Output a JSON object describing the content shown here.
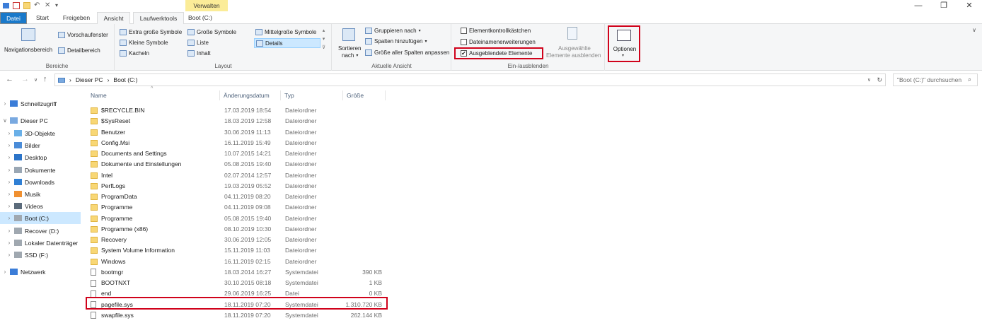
{
  "window": {
    "title": "Boot (C:)",
    "context_tab": "Verwalten",
    "minimize_glyph": "—",
    "maximize_glyph": "❐",
    "close_glyph": "✕"
  },
  "ribbon_tabs": [
    "Datei",
    "Start",
    "Freigeben",
    "Ansicht",
    "Laufwerktools"
  ],
  "ribbon": {
    "bereiche": {
      "nav_pane": "Navigationsbereich",
      "preview": "Vorschaufenster",
      "details": "Detailbereich",
      "label": "Bereiche"
    },
    "layout": {
      "items": [
        "Extra große Symbole",
        "Große Symbole",
        "Mittelgroße Symbole",
        "Kleine Symbole",
        "Liste",
        "Details",
        "Kacheln",
        "Inhalt"
      ],
      "label": "Layout"
    },
    "current_view": {
      "sort": "Sortieren",
      "sort2": "nach",
      "group": "Gruppieren nach",
      "add_cols": "Spalten hinzufügen",
      "fit_cols": "Größe aller Spalten anpassen",
      "label": "Aktuelle Ansicht"
    },
    "show_hide": {
      "item_checkboxes": "Elementkontrollkästchen",
      "extensions": "Dateinamenerweiterungen",
      "hidden_items": "Ausgeblendete Elemente",
      "hide_selected_1": "Ausgewählte",
      "hide_selected_2": "Elemente ausblenden",
      "label": "Ein-/ausblenden",
      "item_checkboxes_checked": false,
      "extensions_checked": false,
      "hidden_items_checked": true
    },
    "options": "Optionen"
  },
  "address": {
    "path": [
      "Dieser PC",
      "Boot (C:)"
    ],
    "search_placeholder": "\"Boot (C:)\" durchsuchen"
  },
  "nav_pane": {
    "items": [
      {
        "label": "Schnellzugriff",
        "icon": "star-icon",
        "level": 0
      },
      {
        "label": "Dieser PC",
        "icon": "computer-icon",
        "level": 0
      },
      {
        "label": "3D-Objekte",
        "icon": "cube-icon",
        "level": 1
      },
      {
        "label": "Bilder",
        "icon": "pictures-icon",
        "level": 1
      },
      {
        "label": "Desktop",
        "icon": "desktop-icon",
        "level": 1
      },
      {
        "label": "Dokumente",
        "icon": "documents-icon",
        "level": 1
      },
      {
        "label": "Downloads",
        "icon": "download-icon",
        "level": 1
      },
      {
        "label": "Musik",
        "icon": "music-icon",
        "level": 1
      },
      {
        "label": "Videos",
        "icon": "video-icon",
        "level": 1
      },
      {
        "label": "Boot (C:)",
        "icon": "drive-icon",
        "level": 1
      },
      {
        "label": "Recover (D:)",
        "icon": "drive-icon",
        "level": 1
      },
      {
        "label": "Lokaler Datenträger",
        "icon": "drive-icon",
        "level": 1
      },
      {
        "label": "SSD (F:)",
        "icon": "drive-icon",
        "level": 1
      },
      {
        "label": "Netzwerk",
        "icon": "network-icon",
        "level": 0
      }
    ]
  },
  "columns": [
    "Name",
    "Änderungsdatum",
    "Typ",
    "Größe"
  ],
  "files": [
    {
      "name": "$RECYCLE.BIN",
      "date": "17.03.2019 18:54",
      "type": "Dateiordner",
      "size": "",
      "kind": "folder"
    },
    {
      "name": "$SysReset",
      "date": "18.03.2019 12:58",
      "type": "Dateiordner",
      "size": "",
      "kind": "folder"
    },
    {
      "name": "Benutzer",
      "date": "30.06.2019 11:13",
      "type": "Dateiordner",
      "size": "",
      "kind": "folder"
    },
    {
      "name": "Config.Msi",
      "date": "16.11.2019 15:49",
      "type": "Dateiordner",
      "size": "",
      "kind": "folder"
    },
    {
      "name": "Documents and Settings",
      "date": "10.07.2015 14:21",
      "type": "Dateiordner",
      "size": "",
      "kind": "link"
    },
    {
      "name": "Dokumente und Einstellungen",
      "date": "05.08.2015 19:40",
      "type": "Dateiordner",
      "size": "",
      "kind": "link"
    },
    {
      "name": "Intel",
      "date": "02.07.2014 12:57",
      "type": "Dateiordner",
      "size": "",
      "kind": "folder"
    },
    {
      "name": "PerfLogs",
      "date": "19.03.2019 05:52",
      "type": "Dateiordner",
      "size": "",
      "kind": "folder"
    },
    {
      "name": "ProgramData",
      "date": "04.11.2019 08:20",
      "type": "Dateiordner",
      "size": "",
      "kind": "folder"
    },
    {
      "name": "Programme",
      "date": "04.11.2019 09:08",
      "type": "Dateiordner",
      "size": "",
      "kind": "folder"
    },
    {
      "name": "Programme",
      "date": "05.08.2015 19:40",
      "type": "Dateiordner",
      "size": "",
      "kind": "link"
    },
    {
      "name": "Programme (x86)",
      "date": "08.10.2019 10:30",
      "type": "Dateiordner",
      "size": "",
      "kind": "folder"
    },
    {
      "name": "Recovery",
      "date": "30.06.2019 12:05",
      "type": "Dateiordner",
      "size": "",
      "kind": "folder"
    },
    {
      "name": "System Volume Information",
      "date": "15.11.2019 11:03",
      "type": "Dateiordner",
      "size": "",
      "kind": "folder"
    },
    {
      "name": "Windows",
      "date": "16.11.2019 02:15",
      "type": "Dateiordner",
      "size": "",
      "kind": "folder"
    },
    {
      "name": "bootmgr",
      "date": "18.03.2014 16:27",
      "type": "Systemdatei",
      "size": "390 KB",
      "kind": "file"
    },
    {
      "name": "BOOTNXT",
      "date": "30.10.2015 08:18",
      "type": "Systemdatei",
      "size": "1 KB",
      "kind": "file"
    },
    {
      "name": "end",
      "date": "29.06.2019 16:25",
      "type": "Datei",
      "size": "0 KB",
      "kind": "file"
    },
    {
      "name": "pagefile.sys",
      "date": "18.11.2019 07:20",
      "type": "Systemdatei",
      "size": "1.310.720 KB",
      "kind": "file"
    },
    {
      "name": "swapfile.sys",
      "date": "18.11.2019 07:20",
      "type": "Systemdatei",
      "size": "262.144 KB",
      "kind": "file"
    }
  ],
  "colors": {
    "accent": "#1979ca",
    "highlight": "#d0021b",
    "selection": "#cce8ff",
    "folder": "#f8d775"
  }
}
